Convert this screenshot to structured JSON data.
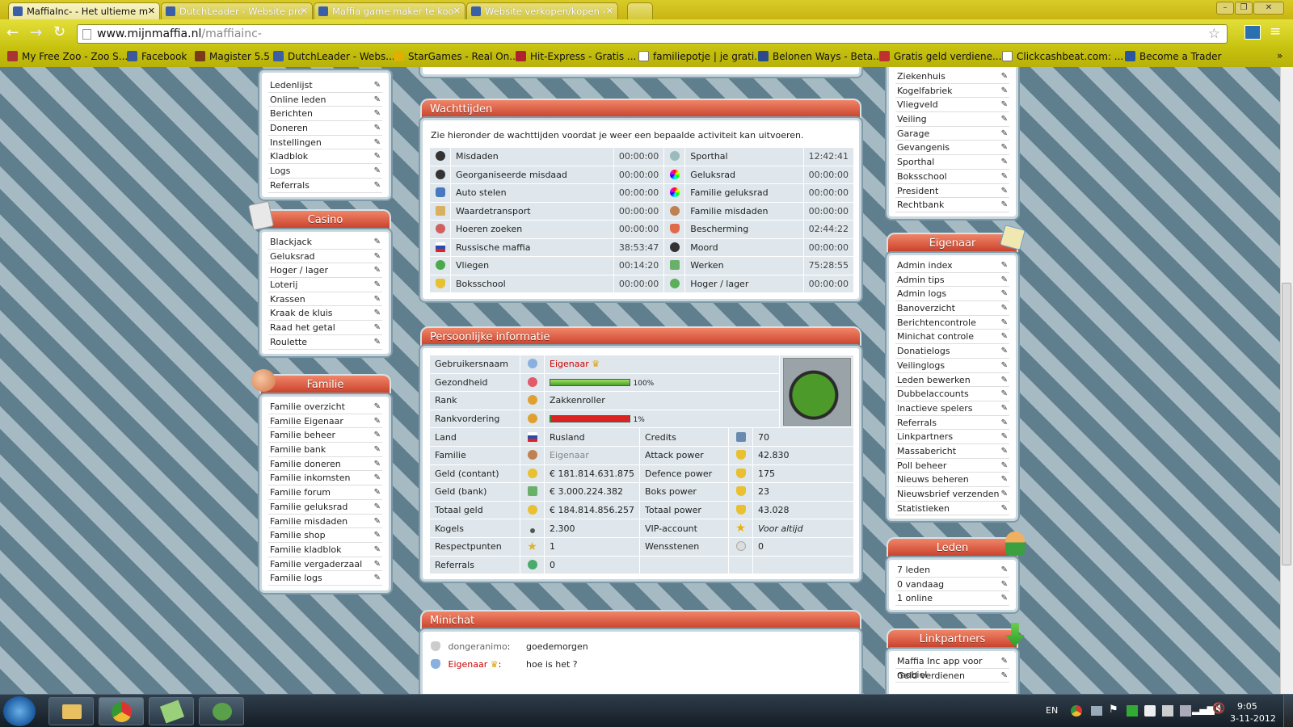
{
  "browser": {
    "tabs": [
      {
        "label": "MaffiaInc- - Het ultieme m"
      },
      {
        "label": "DutchLeader - Website pro"
      },
      {
        "label": "Maffia game maker te koo"
      },
      {
        "label": "Website verkopen/kopen -"
      }
    ],
    "url_domain": "www.mijnmaffia.nl",
    "url_path": "/maffiainc-",
    "bookmarks": [
      "My Free Zoo - Zoo S...",
      "Facebook",
      "Magister 5.5",
      "DutchLeader - Webs...",
      "StarGames - Real On...",
      "Hit-Express - Gratis ...",
      "familiepotje | je grati...",
      "Belonen Ways - Beta...",
      "Gratis geld verdiene...",
      "Clickcashbeat.com: ...",
      "Become a Trader"
    ]
  },
  "left": {
    "top_items": [
      "Ledenlijst",
      "Online leden",
      "Berichten",
      "Doneren",
      "Instellingen",
      "Kladblok",
      "Logs",
      "Referrals"
    ],
    "casino": {
      "title": "Casino",
      "items": [
        "Blackjack",
        "Geluksrad",
        "Hoger / lager",
        "Loterij",
        "Krassen",
        "Kraak de kluis",
        "Raad het getal",
        "Roulette"
      ]
    },
    "familie": {
      "title": "Familie",
      "items": [
        "Familie overzicht",
        "Familie Eigenaar",
        "Familie beheer",
        "Familie bank",
        "Familie doneren",
        "Familie inkomsten",
        "Familie forum",
        "Familie geluksrad",
        "Familie misdaden",
        "Familie shop",
        "Familie kladblok",
        "Familie vergaderzaal",
        "Familie logs"
      ]
    }
  },
  "wacht": {
    "title": "Wachttijden",
    "intro": "Zie hieronder de wachttijden voordat je weer een bepaalde activiteit kan uitvoeren.",
    "rows": [
      [
        "Misdaden",
        "00:00:00",
        "Sporthal",
        "12:42:41"
      ],
      [
        "Georganiseerde misdaad",
        "00:00:00",
        "Geluksrad",
        "00:00:00"
      ],
      [
        "Auto stelen",
        "00:00:00",
        "Familie geluksrad",
        "00:00:00"
      ],
      [
        "Waardetransport",
        "00:00:00",
        "Familie misdaden",
        "00:00:00"
      ],
      [
        "Hoeren zoeken",
        "00:00:00",
        "Bescherming",
        "02:44:22"
      ],
      [
        "Russische maffia",
        "38:53:47",
        "Moord",
        "00:00:00"
      ],
      [
        "Vliegen",
        "00:14:20",
        "Werken",
        "75:28:55"
      ],
      [
        "Boksschool",
        "00:00:00",
        "Hoger / lager",
        "00:00:00"
      ]
    ]
  },
  "persoon": {
    "title": "Persoonlijke informatie",
    "gebruikersnaam_label": "Gebruikersnaam",
    "gebruikersnaam": "Eigenaar",
    "gezondheid_label": "Gezondheid",
    "gezondheid_pct": "100%",
    "gezondheid_value": 100,
    "rank_label": "Rank",
    "rank": "Zakkenroller",
    "rankvordering_label": "Rankvordering",
    "rankvordering_pct": "1%",
    "rankvordering_value": 1,
    "rows": [
      [
        "Land",
        "Rusland",
        "Credits",
        "70"
      ],
      [
        "Familie",
        "Eigenaar",
        "Attack power",
        "42.830"
      ],
      [
        "Geld (contant)",
        "€ 181.814.631.875",
        "Defence power",
        "175"
      ],
      [
        "Geld (bank)",
        "€ 3.000.224.382",
        "Boks power",
        "23"
      ],
      [
        "Totaal geld",
        "€ 184.814.856.257",
        "Totaal power",
        "43.028"
      ],
      [
        "Kogels",
        "2.300",
        "VIP-account",
        "Voor altijd"
      ],
      [
        "Respectpunten",
        "1",
        "Wensstenen",
        "0"
      ],
      [
        "Referrals",
        "0",
        "",
        ""
      ]
    ]
  },
  "minichat": {
    "title": "Minichat",
    "messages": [
      {
        "user": "dongeranimo",
        "text": "goedemorgen"
      },
      {
        "user": "Eigenaar",
        "text": "hoe is het ?"
      }
    ]
  },
  "right": {
    "top_items": [
      "Ziekenhuis",
      "Kogelfabriek",
      "Vliegveld",
      "Veiling",
      "Garage",
      "Gevangenis",
      "Sporthal",
      "Boksschool",
      "President",
      "Rechtbank"
    ],
    "eigenaar": {
      "title": "Eigenaar",
      "items": [
        "Admin index",
        "Admin tips",
        "Admin logs",
        "Banoverzicht",
        "Berichtencontrole",
        "Minichat controle",
        "Donatielogs",
        "Veilinglogs",
        "Leden bewerken",
        "Dubbelaccounts",
        "Inactieve spelers",
        "Referrals",
        "Linkpartners",
        "Massabericht",
        "Poll beheer",
        "Nieuws beheren",
        "Nieuwsbrief verzenden",
        "Statistieken"
      ]
    },
    "leden": {
      "title": "Leden",
      "items": [
        "7 leden",
        "0 vandaag",
        "1 online"
      ]
    },
    "linkpartners": {
      "title": "Linkpartners",
      "items": [
        "Maffia Inc app voor mobiel",
        "Geld verdienen"
      ]
    }
  },
  "taskbar": {
    "lang": "EN",
    "time": "9:05",
    "date": "3-11-2012"
  }
}
